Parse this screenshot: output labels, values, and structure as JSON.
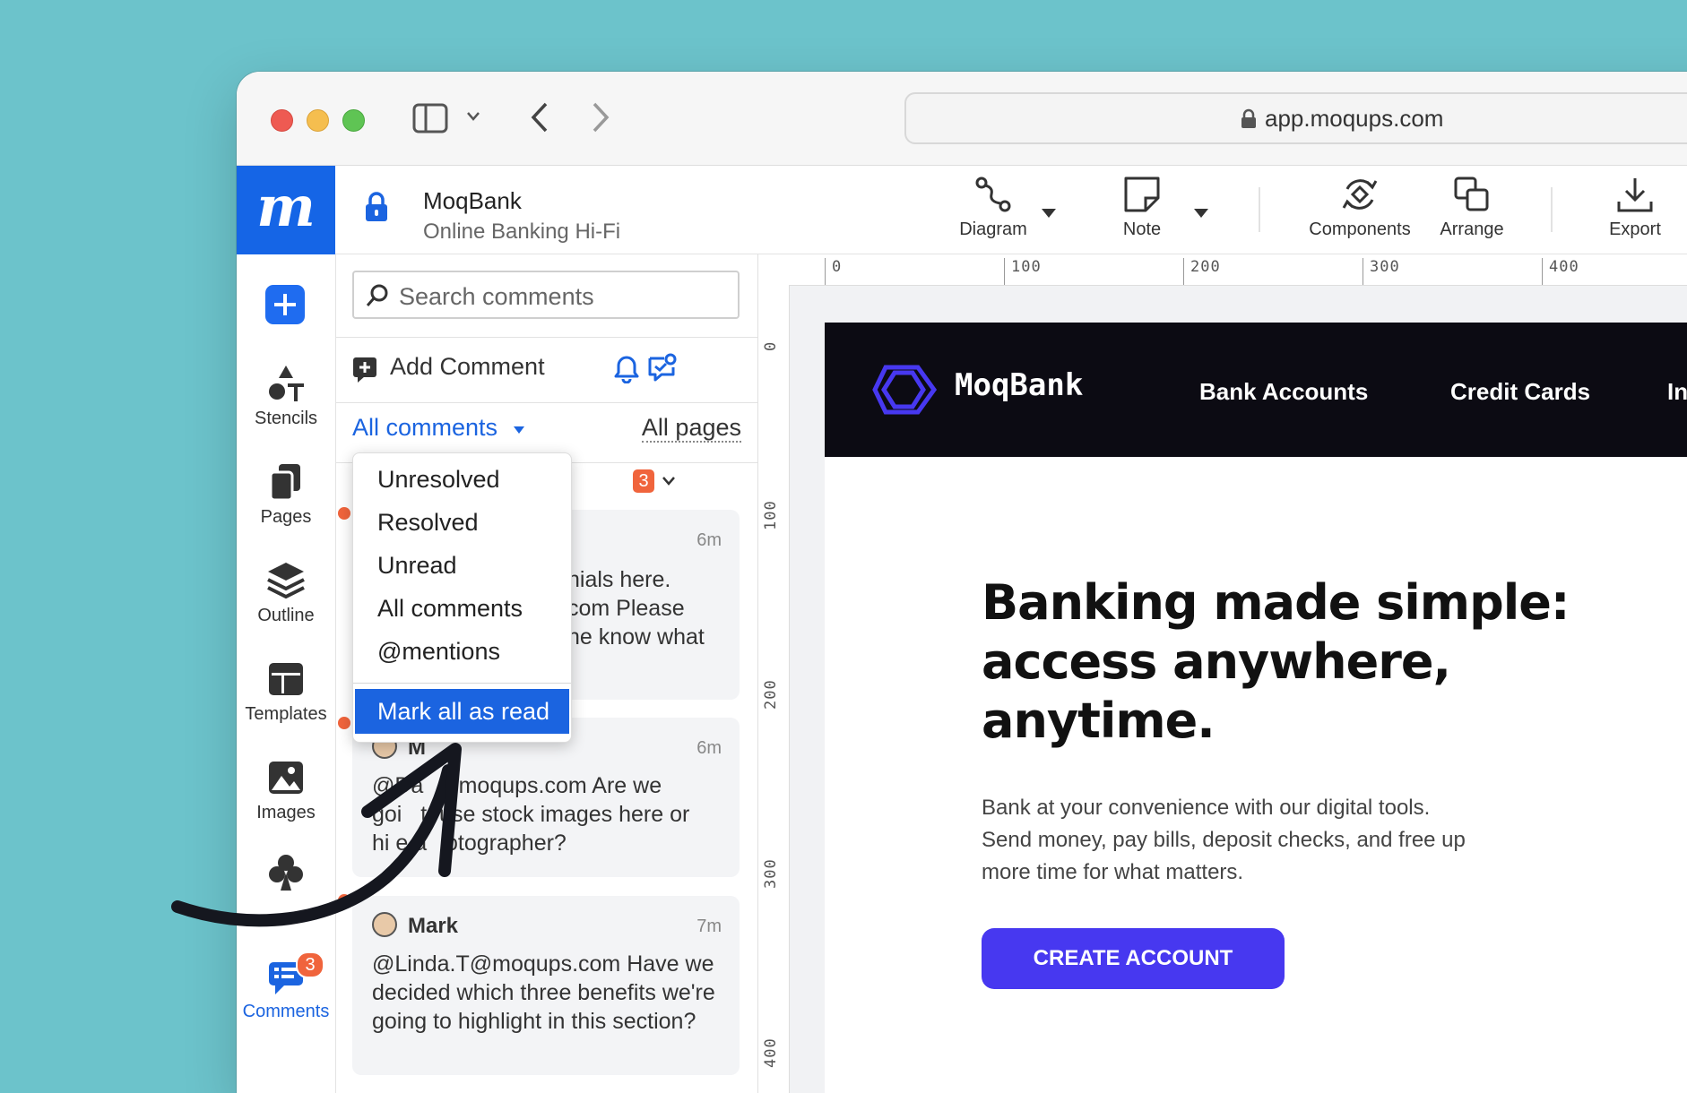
{
  "browser": {
    "url": "app.moqups.com"
  },
  "app": {
    "logo_letter": "m",
    "project_name": "MoqBank",
    "project_subtitle": "Online Banking Hi-Fi",
    "toolbar": {
      "diagram": "Diagram",
      "note": "Note",
      "components": "Components",
      "arrange": "Arrange",
      "export": "Export"
    }
  },
  "leftnav": {
    "items": [
      {
        "label": "Stencils",
        "icon": "stencils-icon"
      },
      {
        "label": "Pages",
        "icon": "pages-icon"
      },
      {
        "label": "Outline",
        "icon": "layers-icon"
      },
      {
        "label": "Templates",
        "icon": "templates-icon"
      },
      {
        "label": "Images",
        "icon": "image-icon"
      },
      {
        "label": "Comments",
        "icon": "comments-icon",
        "badge": "3",
        "active": true
      }
    ]
  },
  "comments": {
    "search_placeholder": "Search comments",
    "add_comment": "Add Comment",
    "filter_label": "All comments",
    "pages_label": "All pages",
    "unread_count": "3",
    "items": [
      {
        "time": "6m",
        "lines": [
          "nials here.",
          "com Please",
          "ne know what"
        ]
      },
      {
        "author": "M",
        "time": "6m",
        "lines": [
          "@Da  @moqups.com Are we",
          "goi   t  use stock images here or",
          "hi e a   otographer?"
        ]
      },
      {
        "author": "Mark",
        "time": "7m",
        "lines": [
          "@Linda.T@moqups.com Have we",
          "decided which three benefits we're",
          "going to highlight in this section?"
        ]
      }
    ]
  },
  "dropdown": {
    "options": [
      "Unresolved",
      "Resolved",
      "Unread",
      "All comments",
      "@mentions"
    ],
    "action": "Mark all as read"
  },
  "rulers": {
    "top": [
      "0",
      "100",
      "200",
      "300",
      "400"
    ],
    "left": [
      "0",
      "100",
      "200",
      "300",
      "400"
    ]
  },
  "design": {
    "brand": "MoqBank",
    "nav_links": [
      "Bank Accounts",
      "Credit Cards",
      "In"
    ],
    "headline_lines": [
      "Banking made simple:",
      "access anywhere,",
      "anytime."
    ],
    "body_lines": [
      "Bank at your convenience with our digital tools.",
      "Send money, pay bills, deposit checks, and free up",
      "more time for what matters."
    ],
    "cta": "CREATE ACCOUNT"
  },
  "colors": {
    "brand_blue": "#1565e6",
    "accent_orange": "#f0643c",
    "cta_purple": "#4738f0",
    "background": "#6cc3cb"
  }
}
